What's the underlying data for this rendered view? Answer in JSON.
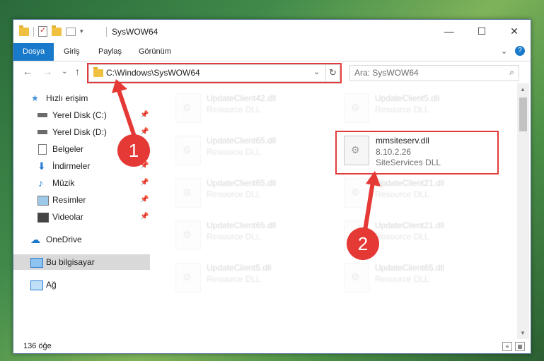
{
  "window": {
    "title": "SysWOW64",
    "minimize": "—",
    "maximize": "☐",
    "close": "✕"
  },
  "ribbon": {
    "tabs": [
      "Dosya",
      "Giriş",
      "Paylaş",
      "Görünüm"
    ],
    "expand": "⌄",
    "help": "?"
  },
  "nav": {
    "back": "←",
    "forward": "→",
    "recent": "⌄",
    "up": "↑",
    "address": "C:\\Windows\\SysWOW64",
    "refresh": "↻",
    "search_placeholder": "Ara: SysWOW64",
    "search_icon": "⌕"
  },
  "sidebar": {
    "items": [
      {
        "label": "Hızlı erişim",
        "icon": "star-icon"
      },
      {
        "label": "Yerel Disk (C:)",
        "icon": "drive-icon",
        "pinned": true
      },
      {
        "label": "Yerel Disk (D:)",
        "icon": "drive-icon",
        "pinned": true
      },
      {
        "label": "Belgeler",
        "icon": "document-icon",
        "pinned": true
      },
      {
        "label": "İndirmeler",
        "icon": "download-icon",
        "pinned": true
      },
      {
        "label": "Müzik",
        "icon": "music-icon",
        "pinned": true
      },
      {
        "label": "Resimler",
        "icon": "picture-icon",
        "pinned": true
      },
      {
        "label": "Videolar",
        "icon": "video-icon",
        "pinned": true
      },
      {
        "label": "OneDrive",
        "icon": "cloud-icon"
      },
      {
        "label": "Bu bilgisayar",
        "icon": "computer-icon",
        "selected": true
      },
      {
        "label": "Ağ",
        "icon": "network-icon"
      }
    ],
    "pin_glyph": "📌"
  },
  "files": [
    {
      "name": "UpdateClient42.dll",
      "type": "Resource DLL"
    },
    {
      "name": "UpdateClient5.dll",
      "type": "Resource DLL"
    },
    {
      "name": "UpdateClient65.dll",
      "type": "Resource DLL"
    },
    {
      "name": "mmsiteserv.dll",
      "version": "8.10.2.26",
      "type": "SiteServices DLL",
      "highlighted": true
    },
    {
      "name": "UpdateClient65.dll",
      "type": "Resource DLL"
    },
    {
      "name": "UpdateClient21.dll",
      "type": "Resource DLL"
    },
    {
      "name": "UpdateClient65.dll",
      "type": "Resource DLL"
    },
    {
      "name": "UpdateClient21.dll",
      "type": "Resource DLL"
    },
    {
      "name": "UpdateClient5.dll",
      "type": "Resource DLL"
    },
    {
      "name": "UpdateClient65.dll",
      "type": "Resource DLL"
    }
  ],
  "status": {
    "count": "136 öğe"
  },
  "annotations": {
    "step1": "1",
    "step2": "2",
    "color": "#e53935"
  }
}
